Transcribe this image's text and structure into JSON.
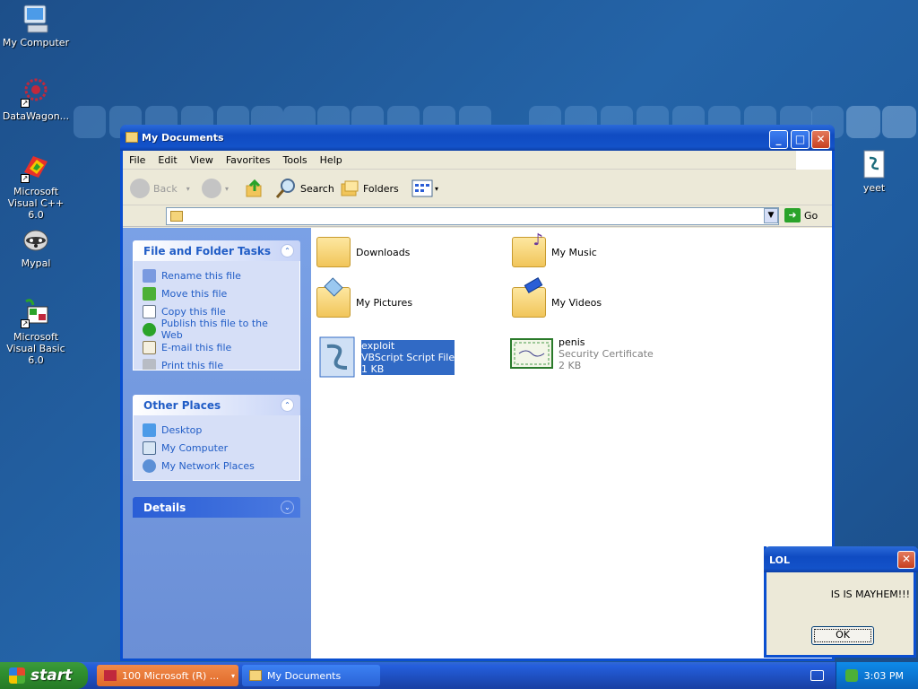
{
  "desktop": {
    "icons": [
      {
        "label": "My Computer"
      },
      {
        "label": "DataWagon..."
      },
      {
        "label": "Microsoft Visual C++ 6.0"
      },
      {
        "label": "Mypal"
      },
      {
        "label": "Microsoft Visual Basic 6.0"
      },
      {
        "label": "yeet"
      }
    ]
  },
  "window": {
    "title": "My Documents",
    "menu": [
      "File",
      "Edit",
      "View",
      "Favorites",
      "Tools",
      "Help"
    ],
    "toolbar": {
      "back": "Back",
      "search": "Search",
      "folders": "Folders"
    },
    "address": {
      "value": "",
      "go": "Go"
    }
  },
  "tasks_panel": {
    "title": "File and Folder Tasks",
    "items": [
      "Rename this file",
      "Move this file",
      "Copy this file",
      "Publish this file to the Web",
      "E-mail this file",
      "Print this file"
    ]
  },
  "places_panel": {
    "title": "Other Places",
    "items": [
      "Desktop",
      "My Computer",
      "My Network Places"
    ]
  },
  "details_panel": {
    "title": "Details"
  },
  "files": [
    {
      "name": "Downloads"
    },
    {
      "name": "My Music"
    },
    {
      "name": "My Pictures"
    },
    {
      "name": "My Videos"
    },
    {
      "name": "exploit",
      "type": "VBScript Script File",
      "size": "1 KB"
    },
    {
      "name": "penis",
      "type": "Security Certificate",
      "size": "2 KB"
    }
  ],
  "dialog": {
    "title": "LOL",
    "message": "IS IS MAYHEM!!!",
    "ok": "OK"
  },
  "taskbar": {
    "start": "start",
    "tasks": [
      "100 Microsoft (R) ...",
      "My Documents"
    ],
    "clock": "3:03 PM"
  }
}
